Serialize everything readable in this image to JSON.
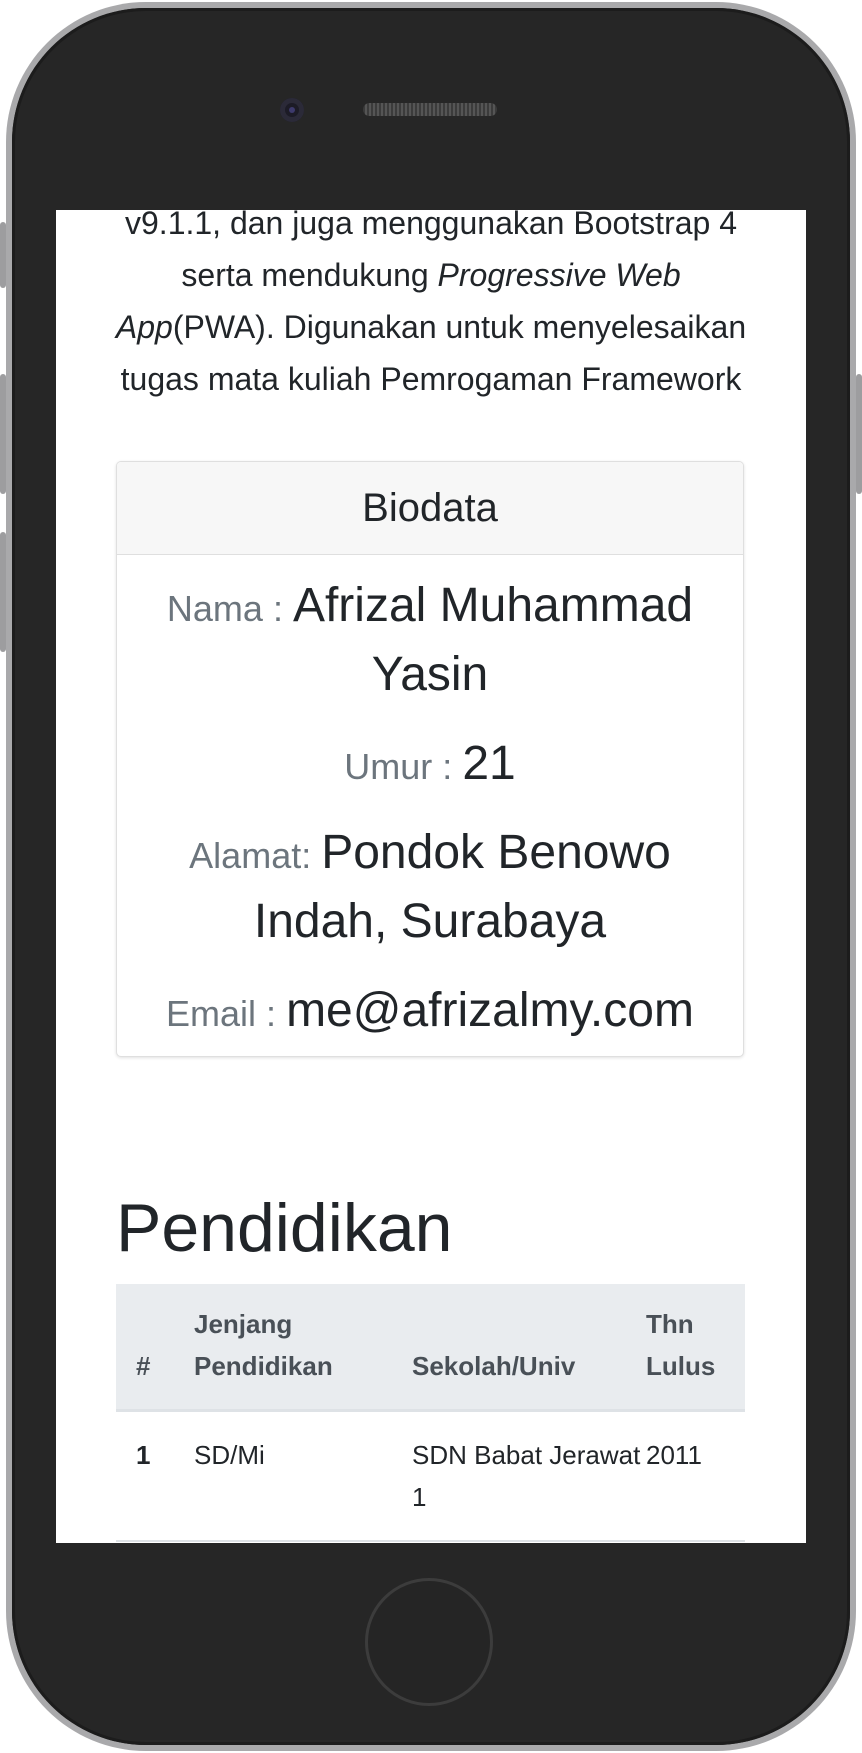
{
  "intro": {
    "line1": "v9.1.1, dan juga menggunakan Bootstrap 4",
    "line2_pre": "serta mendukung ",
    "pwa_italic": "Progressive Web",
    "app_italic": "App",
    "line3_post": "(PWA). Digunakan untuk menyelesaikan",
    "line4": "tugas mata kuliah Pemrogaman Framework"
  },
  "biodata": {
    "title": "Biodata",
    "nama_label": "Nama : ",
    "nama_value": "Afrizal Muhammad Yasin",
    "umur_label": "Umur : ",
    "umur_value": "21",
    "alamat_label": "Alamat: ",
    "alamat_value": "Pondok Benowo Indah, Surabaya",
    "email_label": "Email : ",
    "email_value": "me@afrizalmy.com"
  },
  "pendidikan": {
    "heading": "Pendidikan",
    "columns": [
      "#",
      "Jenjang Pendidikan",
      "Sekolah/Univ",
      "Thn Lulus"
    ],
    "rows": [
      {
        "no": "1",
        "jenjang": "SD/Mi",
        "sekolah": "SDN Babat Jerawat 1",
        "tahun": "2011"
      }
    ]
  }
}
